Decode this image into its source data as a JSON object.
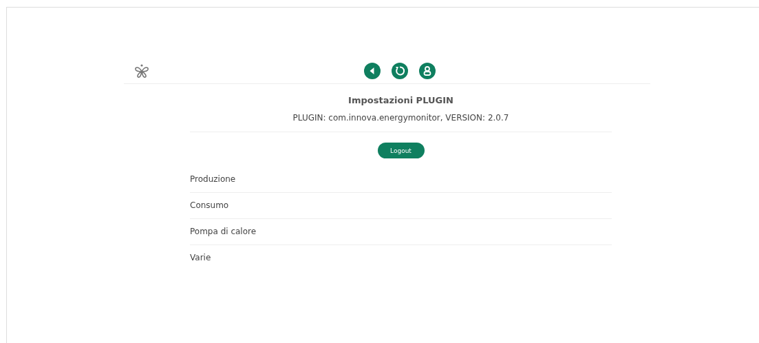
{
  "header": {
    "buttons": [
      {
        "kind": "back"
      },
      {
        "kind": "refresh"
      },
      {
        "kind": "user"
      }
    ]
  },
  "title": "Impostazioni PLUGIN",
  "subtitle": "PLUGIN: com.innova.energymonitor, VERSION: 2.0.7",
  "logout": "Logout",
  "sections": [
    "Produzione",
    "Consumo",
    "Pompa di calore",
    "Varie"
  ]
}
